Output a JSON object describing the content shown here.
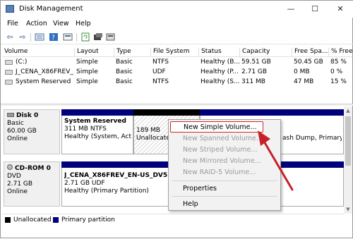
{
  "window": {
    "title": "Disk Management",
    "minimize": "—",
    "maximize": "☐",
    "close": "✕"
  },
  "menu": [
    "File",
    "Action",
    "View",
    "Help"
  ],
  "toolbar": {
    "back": "⇦",
    "forward": "⇨",
    "icons": [
      "list-view-icon",
      "help-icon",
      "properties-icon",
      "refresh-icon",
      "rescan-icon",
      "settings-icon"
    ]
  },
  "volumes": {
    "headers": [
      "Volume",
      "Layout",
      "Type",
      "File System",
      "Status",
      "Capacity",
      "Free Spa...",
      "% Free"
    ],
    "rows": [
      [
        "(C:)",
        "Simple",
        "Basic",
        "NTFS",
        "Healthy (B...",
        "59.51 GB",
        "50.45 GB",
        "85 %"
      ],
      [
        "J_CENA_X86FREV_...",
        "Simple",
        "Basic",
        "UDF",
        "Healthy (P...",
        "2.71 GB",
        "0 MB",
        "0 %"
      ],
      [
        "System Reserved",
        "Simple",
        "Basic",
        "NTFS",
        "Healthy (S...",
        "311 MB",
        "47 MB",
        "15 %"
      ]
    ]
  },
  "disks": [
    {
      "name": "Disk 0",
      "type": "Basic",
      "size": "60.00 GB",
      "status": "Online",
      "partitions": [
        {
          "name": "System Reserved",
          "detail": "311 MB NTFS",
          "status": "Healthy (System, Activ"
        },
        {
          "name": "",
          "detail": "189 MB",
          "status": "Unallocated"
        },
        {
          "name": "",
          "detail": "",
          "status": "ash Dump, Primary"
        }
      ]
    },
    {
      "name": "CD-ROM 0",
      "type": "DVD",
      "size": "2.71 GB",
      "status": "Online",
      "partitions": [
        {
          "name": "J_CENA_X86FREV_EN-US_DV5  (D:",
          "detail": "2.71 GB UDF",
          "status": "Healthy (Primary Partition)"
        }
      ]
    }
  ],
  "legend": [
    {
      "label": "Unallocated",
      "color": "#000000"
    },
    {
      "label": "Primary partition",
      "color": "#00007a"
    }
  ],
  "context_menu": {
    "items": [
      {
        "label": "New Simple Volume...",
        "enabled": true,
        "highlighted": true
      },
      {
        "label": "New Spanned Volume...",
        "enabled": false
      },
      {
        "label": "New Striped Volume...",
        "enabled": false
      },
      {
        "label": "New Mirrored Volume...",
        "enabled": false
      },
      {
        "label": "New RAID-5 Volume...",
        "enabled": false
      },
      {
        "label": "Properties",
        "enabled": true
      },
      {
        "label": "Help",
        "enabled": true
      }
    ]
  },
  "colors": {
    "primary_partition": "#00007a",
    "unallocated": "#000000",
    "highlight_border": "#d0282a",
    "arrow": "#c8202a"
  }
}
